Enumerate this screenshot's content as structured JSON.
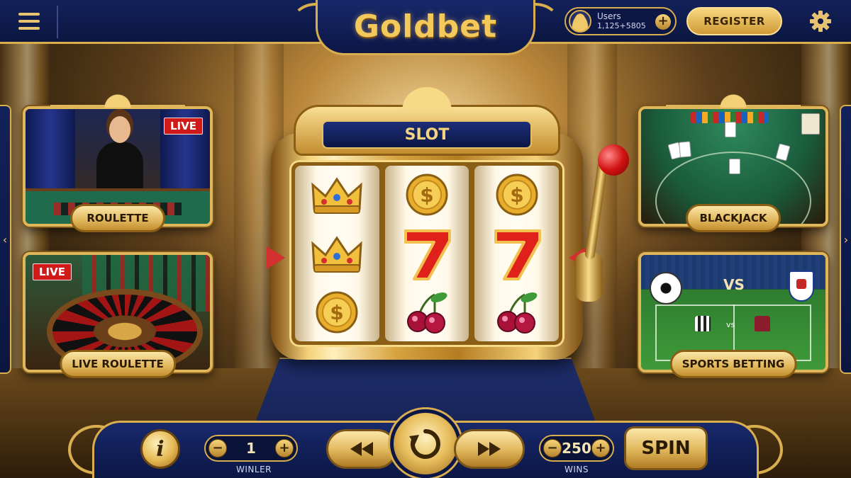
{
  "app": {
    "logo": "Goldbet"
  },
  "header": {
    "users_label": "Users",
    "users_count": "1,125+5805",
    "register_label": "REGISTER",
    "menu_icon": "hamburger-icon",
    "settings_icon": "gear-icon",
    "add_icon": "plus-icon"
  },
  "slot": {
    "title": "SLOT",
    "reels": [
      [
        "crown",
        "crown",
        "coin"
      ],
      [
        "coin",
        "seven",
        "cherry"
      ],
      [
        "coin",
        "seven",
        "cherry"
      ]
    ]
  },
  "games": [
    {
      "label": "ROULETTE",
      "live": "LIVE"
    },
    {
      "label": "LIVE ROULETTE",
      "live": "LIVE"
    },
    {
      "label": "BLACKJACK",
      "live": ""
    },
    {
      "label": "SPORTS BETTING",
      "live": ""
    }
  ],
  "sports": {
    "vs_big": "VS",
    "vs_small": "vs"
  },
  "controls": {
    "info_label": "i",
    "lines_value": "1",
    "lines_caption": "WINLER",
    "bet_value": "250",
    "bet_caption": "WINS",
    "spin_label": "SPIN",
    "minus": "−",
    "plus": "+"
  },
  "colors": {
    "gold": "#d9ae4e",
    "navy": "#0c1746",
    "live_red": "#d01919"
  }
}
